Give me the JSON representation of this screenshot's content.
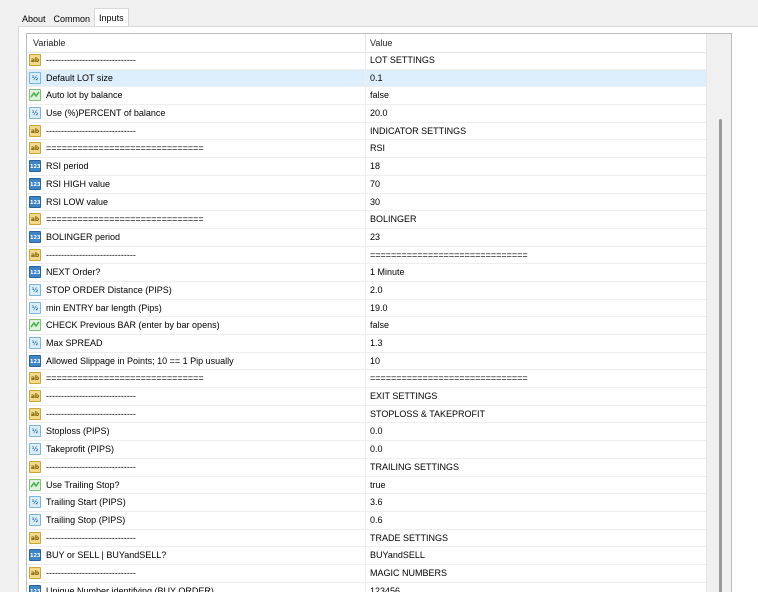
{
  "tabs": [
    {
      "label": "About",
      "active": false
    },
    {
      "label": "Common",
      "active": false
    },
    {
      "label": "Inputs",
      "active": true
    }
  ],
  "table": {
    "headers": {
      "variable": "Variable",
      "value": "Value"
    },
    "rows": [
      {
        "type": "ab",
        "name": "------------------------------",
        "value": "LOT SETTINGS"
      },
      {
        "type": "dbl",
        "name": "Default LOT size",
        "value": "0.1",
        "selected": true
      },
      {
        "type": "bool",
        "name": "Auto lot by balance",
        "value": "false"
      },
      {
        "type": "dbl",
        "name": "Use (%)PERCENT of balance",
        "value": "20.0"
      },
      {
        "type": "ab",
        "name": "------------------------------",
        "value": "INDICATOR SETTINGS"
      },
      {
        "type": "ab",
        "name": "==============================",
        "value": "RSI"
      },
      {
        "type": "int",
        "name": "RSI period",
        "value": "18"
      },
      {
        "type": "int",
        "name": "RSI HIGH value",
        "value": "70"
      },
      {
        "type": "int",
        "name": "RSI LOW value",
        "value": "30"
      },
      {
        "type": "ab",
        "name": "==============================",
        "value": "BOLINGER"
      },
      {
        "type": "int",
        "name": "BOLINGER period",
        "value": "23"
      },
      {
        "type": "ab",
        "name": "------------------------------",
        "value": "=============================="
      },
      {
        "type": "int",
        "name": "NEXT Order?",
        "value": "1 Minute"
      },
      {
        "type": "dbl",
        "name": "STOP ORDER Distance (PIPS)",
        "value": "2.0"
      },
      {
        "type": "dbl",
        "name": "min ENTRY bar length (Pips)",
        "value": "19.0"
      },
      {
        "type": "bool",
        "name": "CHECK Previous BAR (enter by bar opens)",
        "value": "false"
      },
      {
        "type": "dbl",
        "name": "Max SPREAD",
        "value": "1.3"
      },
      {
        "type": "int",
        "name": "Allowed Slippage in Points; 10 == 1 Pip usually",
        "value": "10"
      },
      {
        "type": "ab",
        "name": "==============================",
        "value": "=============================="
      },
      {
        "type": "ab",
        "name": "------------------------------",
        "value": "EXIT SETTINGS"
      },
      {
        "type": "ab",
        "name": "------------------------------",
        "value": "STOPLOSS & TAKEPROFIT"
      },
      {
        "type": "dbl",
        "name": "Stoploss (PIPS)",
        "value": "0.0"
      },
      {
        "type": "dbl",
        "name": "Takeprofit (PIPS)",
        "value": "0.0"
      },
      {
        "type": "ab",
        "name": "------------------------------",
        "value": "TRAILING SETTINGS"
      },
      {
        "type": "bool",
        "name": "Use Trailing Stop?",
        "value": "true"
      },
      {
        "type": "dbl",
        "name": "Trailing Start (PIPS)",
        "value": "3.6"
      },
      {
        "type": "dbl",
        "name": "Trailing Stop (PIPS)",
        "value": "0.6"
      },
      {
        "type": "ab",
        "name": "------------------------------",
        "value": "TRADE SETTINGS"
      },
      {
        "type": "int",
        "name": "BUY or SELL | BUYandSELL?",
        "value": "BUYandSELL"
      },
      {
        "type": "ab",
        "name": "------------------------------",
        "value": "MAGIC NUMBERS"
      },
      {
        "type": "int",
        "name": "Unique Number identifying (BUY ORDER)",
        "value": "123456"
      }
    ]
  },
  "icons": {
    "ab": "string-type-icon",
    "dbl": "double-type-icon",
    "int": "integer-type-icon",
    "bool": "bool-type-icon"
  },
  "icon_glyphs": {
    "ab": "ab",
    "dbl": "½",
    "int": "123"
  },
  "colors": {
    "selected_row": "#ddeefc",
    "string_icon": "#f3d98a",
    "integer_icon": "#3f86c8",
    "bool_icon": "#4caf50"
  }
}
